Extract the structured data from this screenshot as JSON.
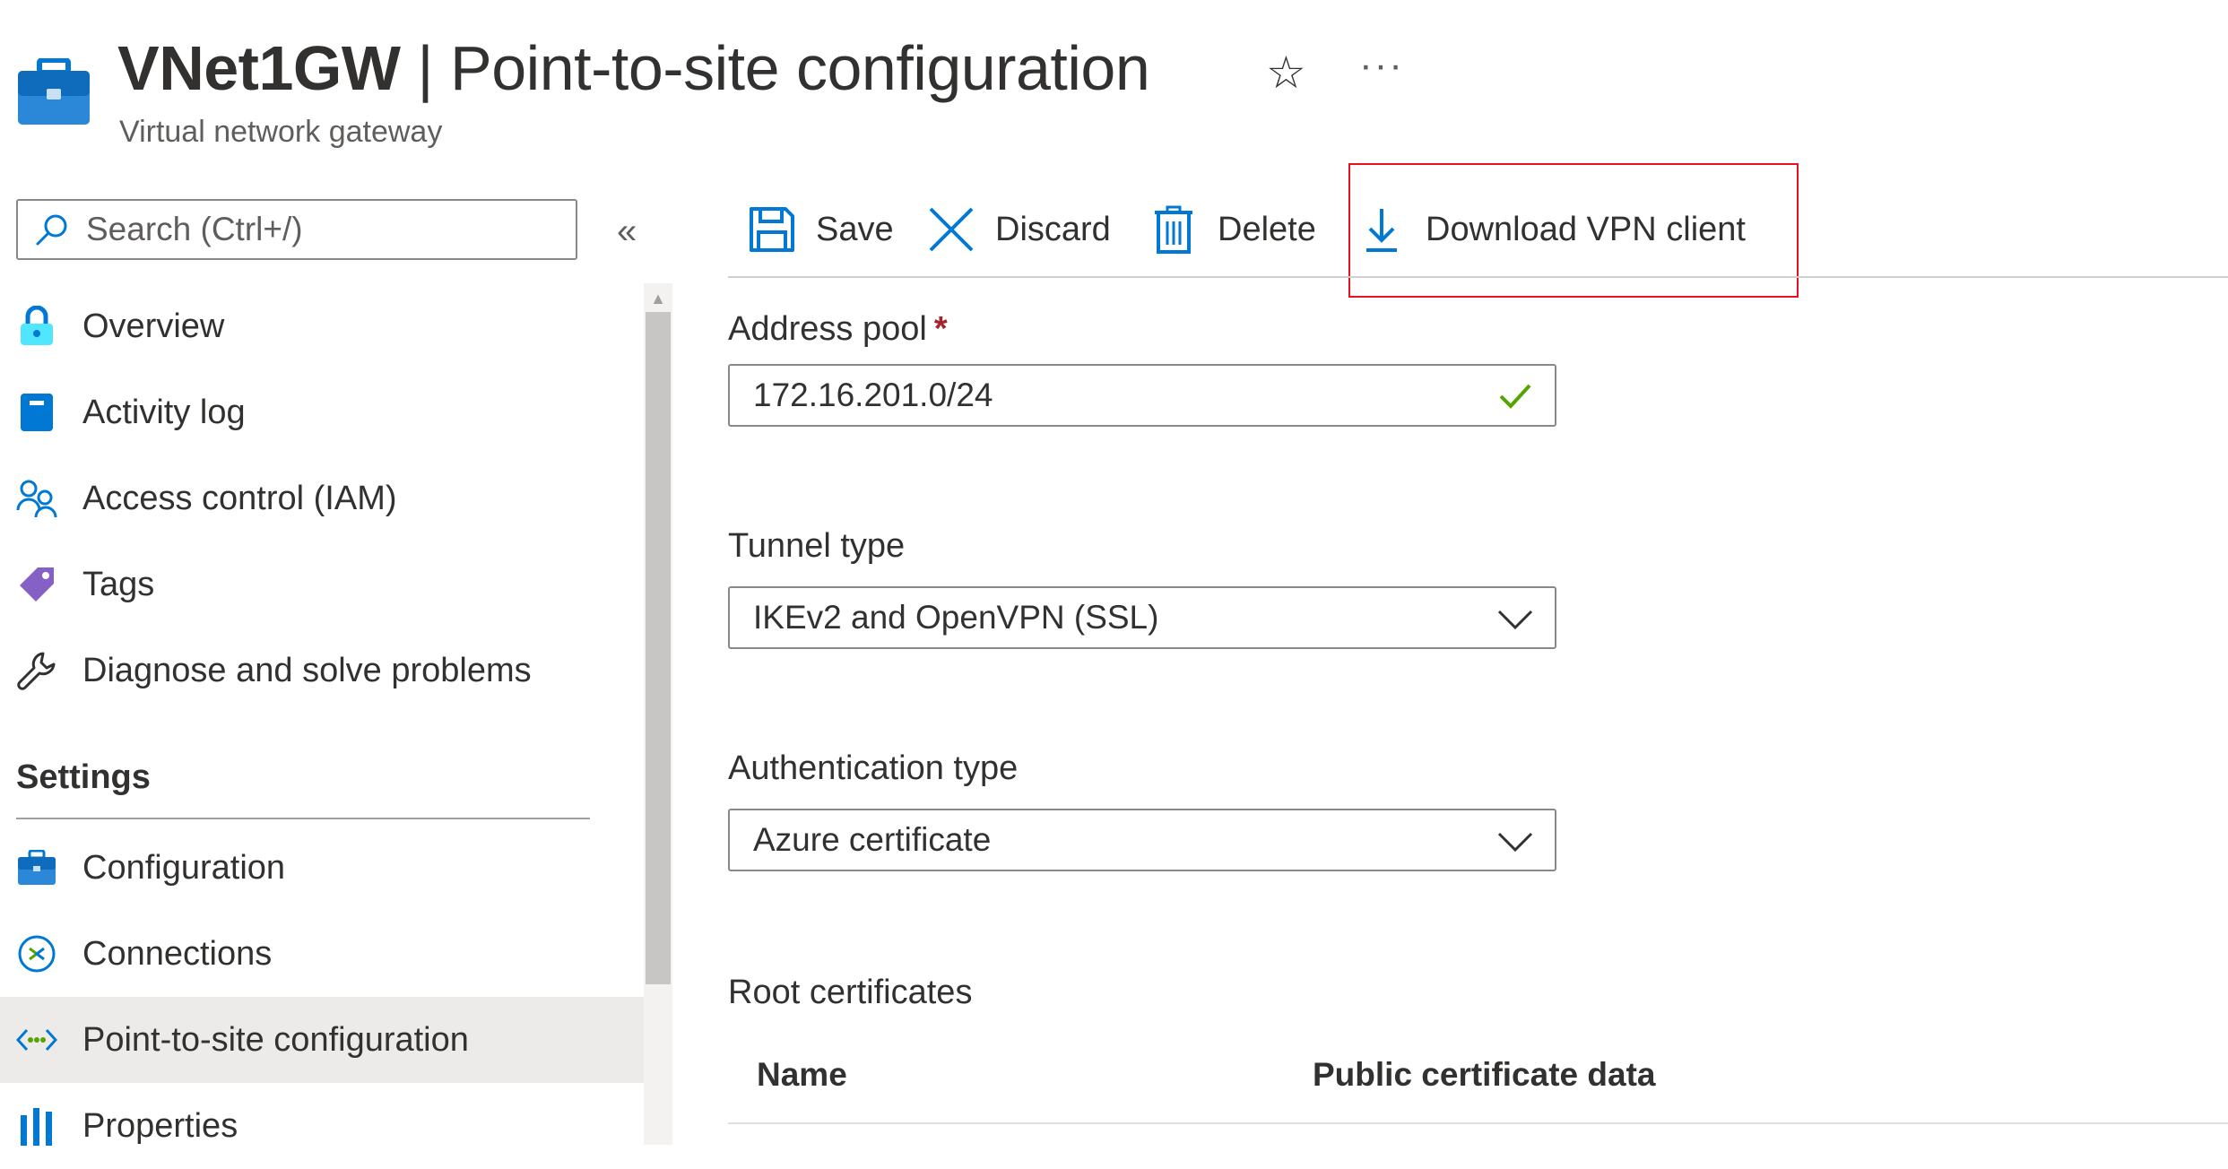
{
  "header": {
    "resource_name": "VNet1GW",
    "separator": " | ",
    "blade_title": "Point-to-site configuration",
    "subtitle": "Virtual network gateway",
    "favorite_icon": "star-icon",
    "more_icon": "ellipsis-icon",
    "more_label": "···"
  },
  "sidebar": {
    "search_placeholder": "Search (Ctrl+/)",
    "collapse_label": "«",
    "items": [
      {
        "label": "Overview",
        "icon": "overview-lock-icon"
      },
      {
        "label": "Activity log",
        "icon": "activity-log-icon"
      },
      {
        "label": "Access control (IAM)",
        "icon": "iam-people-icon"
      },
      {
        "label": "Tags",
        "icon": "tag-icon"
      },
      {
        "label": "Diagnose and solve problems",
        "icon": "wrench-icon"
      }
    ],
    "settings_title": "Settings",
    "settings_items": [
      {
        "label": "Configuration",
        "icon": "briefcase-icon"
      },
      {
        "label": "Connections",
        "icon": "connections-icon"
      },
      {
        "label": "Point-to-site configuration",
        "icon": "point-to-site-icon",
        "active": true
      },
      {
        "label": "Properties",
        "icon": "properties-bars-icon"
      }
    ]
  },
  "toolbar": {
    "save_label": "Save",
    "discard_label": "Discard",
    "delete_label": "Delete",
    "download_label": "Download VPN client"
  },
  "form": {
    "address_pool": {
      "label": "Address pool",
      "required_mark": "*",
      "value": "172.16.201.0/24",
      "valid": true
    },
    "tunnel_type": {
      "label": "Tunnel type",
      "value": "IKEv2 and OpenVPN (SSL)"
    },
    "auth_type": {
      "label": "Authentication type",
      "value": "Azure certificate"
    },
    "root_certs": {
      "title": "Root certificates",
      "columns": [
        "Name",
        "Public certificate data"
      ]
    }
  },
  "colors": {
    "accent": "#0078d4",
    "highlight": "#e81123",
    "valid": "#57a300",
    "required": "#a4262c"
  }
}
